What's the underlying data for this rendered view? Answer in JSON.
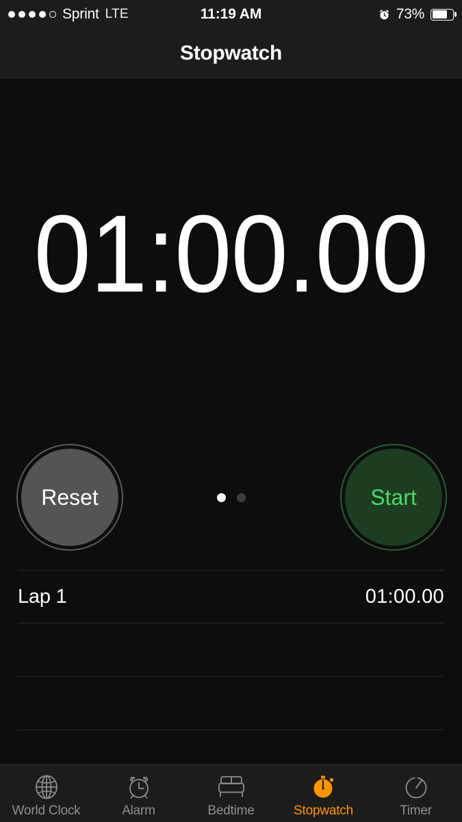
{
  "status_bar": {
    "signal_dots_filled": 4,
    "signal_dots_total": 5,
    "carrier": "Sprint",
    "network": "LTE",
    "time": "11:19 AM",
    "alarm_icon": "alarm-clock-icon",
    "battery_percent": "73%",
    "battery_level": 73
  },
  "nav": {
    "title": "Stopwatch"
  },
  "timer": {
    "value": "01:00.00"
  },
  "controls": {
    "reset_label": "Reset",
    "start_label": "Start",
    "page_dots": [
      {
        "state": "active"
      },
      {
        "state": "inactive"
      }
    ]
  },
  "laps": [
    {
      "name": "Lap 1",
      "time": "01:00.00"
    },
    {
      "name": "",
      "time": ""
    },
    {
      "name": "",
      "time": ""
    }
  ],
  "tabs": [
    {
      "label": "World Clock",
      "icon": "globe-icon",
      "active": false
    },
    {
      "label": "Alarm",
      "icon": "alarm-clock-icon",
      "active": false
    },
    {
      "label": "Bedtime",
      "icon": "bed-icon",
      "active": false
    },
    {
      "label": "Stopwatch",
      "icon": "stopwatch-icon",
      "active": true
    },
    {
      "label": "Timer",
      "icon": "timer-icon",
      "active": false
    }
  ],
  "colors": {
    "accent_orange": "#ff9500",
    "start_green": "#4cd964",
    "background": "#0d0d0d",
    "chrome": "#1c1c1c",
    "inactive_tab": "#8e8e93"
  }
}
